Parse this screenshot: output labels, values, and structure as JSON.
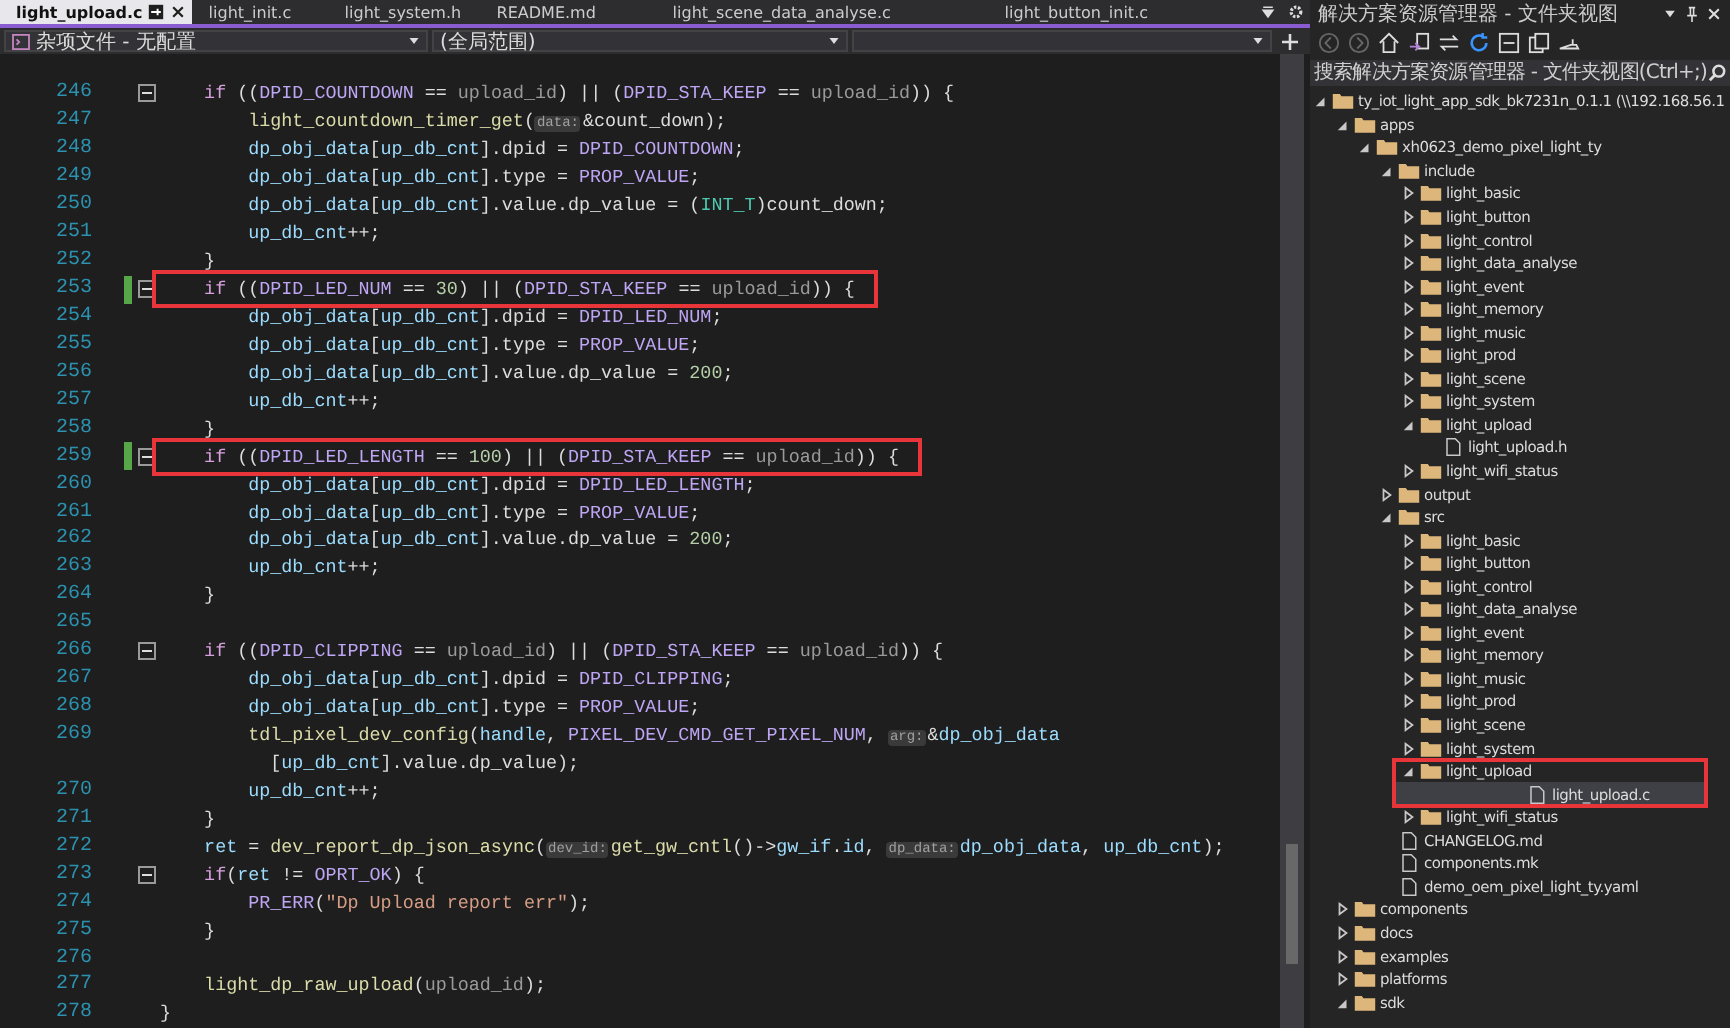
{
  "tabs": [
    {
      "label": "light_upload.c",
      "selected": true
    },
    {
      "label": "light_init.c",
      "selected": false
    },
    {
      "label": "light_system.h",
      "selected": false
    },
    {
      "label": "README.md",
      "selected": false
    },
    {
      "label": "light_scene_data_analyse.c",
      "selected": false
    },
    {
      "label": "light_button_init.c",
      "selected": false
    }
  ],
  "navigation": [
    {
      "kind": "project",
      "label": "杂项文件 - 无配置"
    },
    {
      "kind": "scope",
      "label": "(全局范围)"
    },
    {
      "kind": "member"
    }
  ],
  "editor": {
    "lines": [
      {
        "num": "246",
        "fold": true,
        "tokens": [
          {
            "kind": "kw",
            "text": "    if"
          },
          {
            "kind": "op",
            "text": " (("
          },
          {
            "kind": "macro",
            "text": "DPID_COUNTDOWN"
          },
          {
            "kind": "op",
            "text": " == "
          },
          {
            "kind": "param",
            "text": "upload_id"
          },
          {
            "kind": "op",
            "text": ") || ("
          },
          {
            "kind": "macro",
            "text": "DPID_STA_KEEP"
          },
          {
            "kind": "op",
            "text": " == "
          },
          {
            "kind": "param",
            "text": "upload_id"
          },
          {
            "kind": "op",
            "text": ")) {"
          }
        ]
      },
      {
        "num": "247",
        "tokens": [
          {
            "kind": "fn",
            "text": "        light_countdown_timer_get"
          },
          {
            "kind": "op",
            "text": "("
          },
          {
            "kind": "hint",
            "text": "data:"
          },
          {
            "kind": "op",
            "text": "&count_down);"
          }
        ]
      },
      {
        "num": "248",
        "tokens": [
          {
            "kind": "var",
            "text": "        dp_obj_data"
          },
          {
            "kind": "op",
            "text": "["
          },
          {
            "kind": "var",
            "text": "up_db_cnt"
          },
          {
            "kind": "op",
            "text": "].dpid = "
          },
          {
            "kind": "macro",
            "text": "DPID_COUNTDOWN"
          },
          {
            "kind": "op",
            "text": ";"
          }
        ]
      },
      {
        "num": "249",
        "tokens": [
          {
            "kind": "var",
            "text": "        dp_obj_data"
          },
          {
            "kind": "op",
            "text": "["
          },
          {
            "kind": "var",
            "text": "up_db_cnt"
          },
          {
            "kind": "op",
            "text": "].type = "
          },
          {
            "kind": "macro",
            "text": "PROP_VALUE"
          },
          {
            "kind": "op",
            "text": ";"
          }
        ]
      },
      {
        "num": "250",
        "tokens": [
          {
            "kind": "var",
            "text": "        dp_obj_data"
          },
          {
            "kind": "op",
            "text": "["
          },
          {
            "kind": "var",
            "text": "up_db_cnt"
          },
          {
            "kind": "op",
            "text": "].value.dp_value = ("
          },
          {
            "kind": "type",
            "text": "INT_T"
          },
          {
            "kind": "op",
            "text": ")count_down;"
          }
        ]
      },
      {
        "num": "251",
        "tokens": [
          {
            "kind": "var",
            "text": "        up_db_cnt"
          },
          {
            "kind": "op",
            "text": "++;"
          }
        ]
      },
      {
        "num": "252",
        "tokens": [
          {
            "kind": "op",
            "text": "    }"
          }
        ]
      },
      {
        "num": "253",
        "fold": true,
        "changed": true,
        "boxed": true,
        "tokens": [
          {
            "kind": "kw",
            "text": "    if"
          },
          {
            "kind": "op",
            "text": " (("
          },
          {
            "kind": "macro",
            "text": "DPID_LED_NUM"
          },
          {
            "kind": "op",
            "text": " == "
          },
          {
            "kind": "num",
            "text": "30"
          },
          {
            "kind": "op",
            "text": ") || ("
          },
          {
            "kind": "macro",
            "text": "DPID_STA_KEEP"
          },
          {
            "kind": "op",
            "text": " == "
          },
          {
            "kind": "param",
            "text": "upload_id"
          },
          {
            "kind": "op",
            "text": ")) {"
          }
        ]
      },
      {
        "num": "254",
        "tokens": [
          {
            "kind": "var",
            "text": "        dp_obj_data"
          },
          {
            "kind": "op",
            "text": "["
          },
          {
            "kind": "var",
            "text": "up_db_cnt"
          },
          {
            "kind": "op",
            "text": "].dpid = "
          },
          {
            "kind": "macro",
            "text": "DPID_LED_NUM"
          },
          {
            "kind": "op",
            "text": ";"
          }
        ]
      },
      {
        "num": "255",
        "tokens": [
          {
            "kind": "var",
            "text": "        dp_obj_data"
          },
          {
            "kind": "op",
            "text": "["
          },
          {
            "kind": "var",
            "text": "up_db_cnt"
          },
          {
            "kind": "op",
            "text": "].type = "
          },
          {
            "kind": "macro",
            "text": "PROP_VALUE"
          },
          {
            "kind": "op",
            "text": ";"
          }
        ]
      },
      {
        "num": "256",
        "tokens": [
          {
            "kind": "var",
            "text": "        dp_obj_data"
          },
          {
            "kind": "op",
            "text": "["
          },
          {
            "kind": "var",
            "text": "up_db_cnt"
          },
          {
            "kind": "op",
            "text": "].value.dp_value = "
          },
          {
            "kind": "num",
            "text": "200"
          },
          {
            "kind": "op",
            "text": ";"
          }
        ]
      },
      {
        "num": "257",
        "tokens": [
          {
            "kind": "var",
            "text": "        up_db_cnt"
          },
          {
            "kind": "op",
            "text": "++;"
          }
        ]
      },
      {
        "num": "258",
        "tokens": [
          {
            "kind": "op",
            "text": "    }"
          }
        ]
      },
      {
        "num": "259",
        "fold": true,
        "changed": true,
        "boxed": true,
        "tokens": [
          {
            "kind": "kw",
            "text": "    if"
          },
          {
            "kind": "op",
            "text": " (("
          },
          {
            "kind": "macro",
            "text": "DPID_LED_LENGTH"
          },
          {
            "kind": "op",
            "text": " == "
          },
          {
            "kind": "num",
            "text": "100"
          },
          {
            "kind": "op",
            "text": ") || ("
          },
          {
            "kind": "macro",
            "text": "DPID_STA_KEEP"
          },
          {
            "kind": "op",
            "text": " == "
          },
          {
            "kind": "param",
            "text": "upload_id"
          },
          {
            "kind": "op",
            "text": ")) {"
          }
        ]
      },
      {
        "num": "260",
        "tokens": [
          {
            "kind": "var",
            "text": "        dp_obj_data"
          },
          {
            "kind": "op",
            "text": "["
          },
          {
            "kind": "var",
            "text": "up_db_cnt"
          },
          {
            "kind": "op",
            "text": "].dpid = "
          },
          {
            "kind": "macro",
            "text": "DPID_LED_LENGTH"
          },
          {
            "kind": "op",
            "text": ";"
          }
        ]
      },
      {
        "num": "261",
        "tokens": [
          {
            "kind": "var",
            "text": "        dp_obj_data"
          },
          {
            "kind": "op",
            "text": "["
          },
          {
            "kind": "var",
            "text": "up_db_cnt"
          },
          {
            "kind": "op",
            "text": "].type = "
          },
          {
            "kind": "macro",
            "text": "PROP_VALUE"
          },
          {
            "kind": "op",
            "text": ";"
          }
        ]
      },
      {
        "num": "262",
        "tokens": [
          {
            "kind": "var",
            "text": "        dp_obj_data"
          },
          {
            "kind": "op",
            "text": "["
          },
          {
            "kind": "var",
            "text": "up_db_cnt"
          },
          {
            "kind": "op",
            "text": "].value.dp_value = "
          },
          {
            "kind": "num",
            "text": "200"
          },
          {
            "kind": "op",
            "text": ";"
          }
        ]
      },
      {
        "num": "263",
        "tokens": [
          {
            "kind": "var",
            "text": "        up_db_cnt"
          },
          {
            "kind": "op",
            "text": "++;"
          }
        ]
      },
      {
        "num": "264",
        "tokens": [
          {
            "kind": "op",
            "text": "    }"
          }
        ]
      },
      {
        "num": "265"
      },
      {
        "num": "266",
        "fold": true,
        "tokens": [
          {
            "kind": "kw",
            "text": "    if"
          },
          {
            "kind": "op",
            "text": " (("
          },
          {
            "kind": "macro",
            "text": "DPID_CLIPPING"
          },
          {
            "kind": "op",
            "text": " == "
          },
          {
            "kind": "param",
            "text": "upload_id"
          },
          {
            "kind": "op",
            "text": ") || ("
          },
          {
            "kind": "macro",
            "text": "DPID_STA_KEEP"
          },
          {
            "kind": "op",
            "text": " == "
          },
          {
            "kind": "param",
            "text": "upload_id"
          },
          {
            "kind": "op",
            "text": ")) {"
          }
        ]
      },
      {
        "num": "267",
        "tokens": [
          {
            "kind": "var",
            "text": "        dp_obj_data"
          },
          {
            "kind": "op",
            "text": "["
          },
          {
            "kind": "var",
            "text": "up_db_cnt"
          },
          {
            "kind": "op",
            "text": "].dpid = "
          },
          {
            "kind": "macro",
            "text": "DPID_CLIPPING"
          },
          {
            "kind": "op",
            "text": ";"
          }
        ]
      },
      {
        "num": "268",
        "tokens": [
          {
            "kind": "var",
            "text": "        dp_obj_data"
          },
          {
            "kind": "op",
            "text": "["
          },
          {
            "kind": "var",
            "text": "up_db_cnt"
          },
          {
            "kind": "op",
            "text": "].type = "
          },
          {
            "kind": "macro",
            "text": "PROP_VALUE"
          },
          {
            "kind": "op",
            "text": ";"
          }
        ]
      },
      {
        "num": "269",
        "tokens": [
          {
            "kind": "fn",
            "text": "        tdl_pixel_dev_config"
          },
          {
            "kind": "op",
            "text": "("
          },
          {
            "kind": "var",
            "text": "handle"
          },
          {
            "kind": "op",
            "text": ", "
          },
          {
            "kind": "macro",
            "text": "PIXEL_DEV_CMD_GET_PIXEL_NUM"
          },
          {
            "kind": "op",
            "text": ", "
          },
          {
            "kind": "hint",
            "text": "arg:"
          },
          {
            "kind": "op",
            "text": "&"
          },
          {
            "kind": "var",
            "text": "dp_obj_data"
          }
        ]
      },
      {
        "tokens": [
          {
            "kind": "op",
            "text": "          ["
          },
          {
            "kind": "var",
            "text": "up_db_cnt"
          },
          {
            "kind": "op",
            "text": "].value.dp_value);"
          }
        ]
      },
      {
        "num": "270",
        "tokens": [
          {
            "kind": "var",
            "text": "        up_db_cnt"
          },
          {
            "kind": "op",
            "text": "++;"
          }
        ]
      },
      {
        "num": "271",
        "tokens": [
          {
            "kind": "op",
            "text": "    }"
          }
        ]
      },
      {
        "num": "272",
        "tokens": [
          {
            "kind": "var",
            "text": "    ret"
          },
          {
            "kind": "op",
            "text": " = "
          },
          {
            "kind": "fn",
            "text": "dev_report_dp_json_async"
          },
          {
            "kind": "op",
            "text": "("
          },
          {
            "kind": "hint",
            "text": "dev_id:"
          },
          {
            "kind": "fn",
            "text": "get_gw_cntl"
          },
          {
            "kind": "op",
            "text": "()->"
          },
          {
            "kind": "var",
            "text": "gw_if"
          },
          {
            "kind": "op",
            "text": "."
          },
          {
            "kind": "var",
            "text": "id"
          },
          {
            "kind": "op",
            "text": ", "
          },
          {
            "kind": "hint",
            "text": "dp_data:"
          },
          {
            "kind": "var",
            "text": "dp_obj_data"
          },
          {
            "kind": "op",
            "text": ", "
          },
          {
            "kind": "var",
            "text": "up_db_cnt"
          },
          {
            "kind": "op",
            "text": ");"
          }
        ]
      },
      {
        "num": "273",
        "fold": true,
        "tokens": [
          {
            "kind": "kw",
            "text": "    if"
          },
          {
            "kind": "op",
            "text": "("
          },
          {
            "kind": "var",
            "text": "ret"
          },
          {
            "kind": "op",
            "text": " != "
          },
          {
            "kind": "macro",
            "text": "OPRT_OK"
          },
          {
            "kind": "op",
            "text": ") {"
          }
        ]
      },
      {
        "num": "274",
        "tokens": [
          {
            "kind": "macro",
            "text": "        PR_ERR"
          },
          {
            "kind": "op",
            "text": "("
          },
          {
            "kind": "str",
            "text": "\"Dp Upload report err\""
          },
          {
            "kind": "op",
            "text": ");"
          }
        ]
      },
      {
        "num": "275",
        "tokens": [
          {
            "kind": "op",
            "text": "    }"
          }
        ]
      },
      {
        "num": "276"
      },
      {
        "num": "277",
        "tokens": [
          {
            "kind": "fn",
            "text": "    light_dp_raw_upload"
          },
          {
            "kind": "op",
            "text": "("
          },
          {
            "kind": "param",
            "text": "upload_id"
          },
          {
            "kind": "op",
            "text": ");"
          }
        ]
      },
      {
        "num": "278",
        "tokens": [
          {
            "kind": "op",
            "text": "}"
          }
        ]
      }
    ]
  },
  "explorer": {
    "title": "解决方案资源管理器 - 文件夹视图",
    "search": {
      "placeholder": "搜索解决方案资源管理器 - 文件夹视图(Ctrl+;)"
    },
    "tree": [
      {
        "label": "ty_iot_light_app_sdk_bk7231n_0.1.1 (\\\\192.168.56.1",
        "kind": "folder",
        "expanded": true,
        "selected": false,
        "children": [
          {
            "label": "apps",
            "kind": "folder",
            "expanded": true,
            "selected": false,
            "children": [
              {
                "label": "xh0623_demo_pixel_light_ty",
                "kind": "folder",
                "expanded": true,
                "selected": false,
                "children": [
                  {
                    "label": "include",
                    "kind": "folder",
                    "expanded": true,
                    "selected": false,
                    "children": [
                      {
                        "label": "light_basic",
                        "kind": "folder",
                        "expanded": false,
                        "selected": false
                      },
                      {
                        "label": "light_button",
                        "kind": "folder",
                        "expanded": false,
                        "selected": false
                      },
                      {
                        "label": "light_control",
                        "kind": "folder",
                        "expanded": false,
                        "selected": false
                      },
                      {
                        "label": "light_data_analyse",
                        "kind": "folder",
                        "expanded": false,
                        "selected": false
                      },
                      {
                        "label": "light_event",
                        "kind": "folder",
                        "expanded": false,
                        "selected": false
                      },
                      {
                        "label": "light_memory",
                        "kind": "folder",
                        "expanded": false,
                        "selected": false
                      },
                      {
                        "label": "light_music",
                        "kind": "folder",
                        "expanded": false,
                        "selected": false
                      },
                      {
                        "label": "light_prod",
                        "kind": "folder",
                        "expanded": false,
                        "selected": false
                      },
                      {
                        "label": "light_scene",
                        "kind": "folder",
                        "expanded": false,
                        "selected": false
                      },
                      {
                        "label": "light_system",
                        "kind": "folder",
                        "expanded": false,
                        "selected": false
                      },
                      {
                        "label": "light_upload",
                        "kind": "folder",
                        "expanded": true,
                        "selected": false,
                        "children": [
                          {
                            "label": "light_upload.h",
                            "kind": "file",
                            "selected": false
                          }
                        ]
                      },
                      {
                        "label": "light_wifi_status",
                        "kind": "folder",
                        "expanded": false,
                        "selected": false
                      }
                    ]
                  },
                  {
                    "label": "output",
                    "kind": "folder",
                    "expanded": false,
                    "selected": false
                  },
                  {
                    "label": "src",
                    "kind": "folder",
                    "expanded": true,
                    "selected": false,
                    "children": [
                      {
                        "label": "light_basic",
                        "kind": "folder",
                        "expanded": false,
                        "selected": false
                      },
                      {
                        "label": "light_button",
                        "kind": "folder",
                        "expanded": false,
                        "selected": false
                      },
                      {
                        "label": "light_control",
                        "kind": "folder",
                        "expanded": false,
                        "selected": false
                      },
                      {
                        "label": "light_data_analyse",
                        "kind": "folder",
                        "expanded": false,
                        "selected": false
                      },
                      {
                        "label": "light_event",
                        "kind": "folder",
                        "expanded": false,
                        "selected": false
                      },
                      {
                        "label": "light_memory",
                        "kind": "folder",
                        "expanded": false,
                        "selected": false
                      },
                      {
                        "label": "light_music",
                        "kind": "folder",
                        "expanded": false,
                        "selected": false
                      },
                      {
                        "label": "light_prod",
                        "kind": "folder",
                        "expanded": false,
                        "selected": false
                      },
                      {
                        "label": "light_scene",
                        "kind": "folder",
                        "expanded": false,
                        "selected": false
                      },
                      {
                        "label": "light_system",
                        "kind": "folder",
                        "expanded": false,
                        "selected": false
                      },
                      {
                        "label": "light_upload",
                        "kind": "folder",
                        "expanded": true,
                        "selected": false,
                        "boxed": true,
                        "children": [
                          {
                            "label": "light_upload.c",
                            "kind": "file",
                            "selected": true
                          }
                        ]
                      },
                      {
                        "label": "light_wifi_status",
                        "kind": "folder",
                        "expanded": false,
                        "selected": false
                      }
                    ]
                  },
                  {
                    "label": "CHANGELOG.md",
                    "kind": "file",
                    "selected": false
                  },
                  {
                    "label": "components.mk",
                    "kind": "file",
                    "selected": false
                  },
                  {
                    "label": "demo_oem_pixel_light_ty.yaml",
                    "kind": "file",
                    "selected": false
                  }
                ]
              }
            ]
          },
          {
            "label": "components",
            "kind": "folder",
            "expanded": false,
            "selected": false
          },
          {
            "label": "docs",
            "kind": "folder",
            "expanded": false,
            "selected": false
          },
          {
            "label": "examples",
            "kind": "folder",
            "expanded": false,
            "selected": false
          },
          {
            "label": "platforms",
            "kind": "folder",
            "expanded": false,
            "selected": false
          },
          {
            "label": "sdk",
            "kind": "folder",
            "expanded": true,
            "selected": false
          }
        ]
      }
    ]
  }
}
